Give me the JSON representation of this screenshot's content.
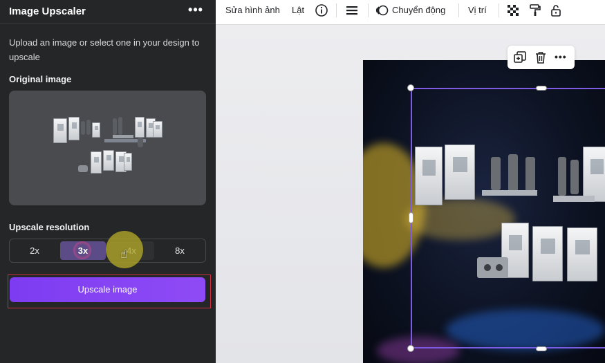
{
  "panel": {
    "title": "Image Upscaler",
    "more_label": "•••",
    "description": "Upload an image or select one in your design to upscale",
    "original_label": "Original image",
    "resolution_label": "Upscale resolution",
    "resolution_options": [
      "2x",
      "3x",
      "4x",
      "8x"
    ],
    "selected_resolution": "3x",
    "upscale_button": "Upscale image",
    "collapse_glyph": "‹"
  },
  "toolbar": {
    "edit_image": "Sửa hình ảnh",
    "flip": "Lật",
    "info_icon": "info-icon",
    "lines_icon": "lines-icon",
    "animate": "Chuyển động",
    "position": "Vị trí",
    "transparency_icon": "checkerboard-icon",
    "paint_icon": "paint-roller-icon",
    "lock_icon": "unlock-icon"
  },
  "element_toolbar": {
    "copy_icon": "duplicate-icon",
    "delete_icon": "trash-icon",
    "more_label": "•••"
  },
  "colors": {
    "panel_bg": "#252627",
    "accent": "#8b45f5",
    "selection": "#7c5ce3",
    "highlight_border": "#d22d3c",
    "cursor_halo": "#b2a828"
  }
}
